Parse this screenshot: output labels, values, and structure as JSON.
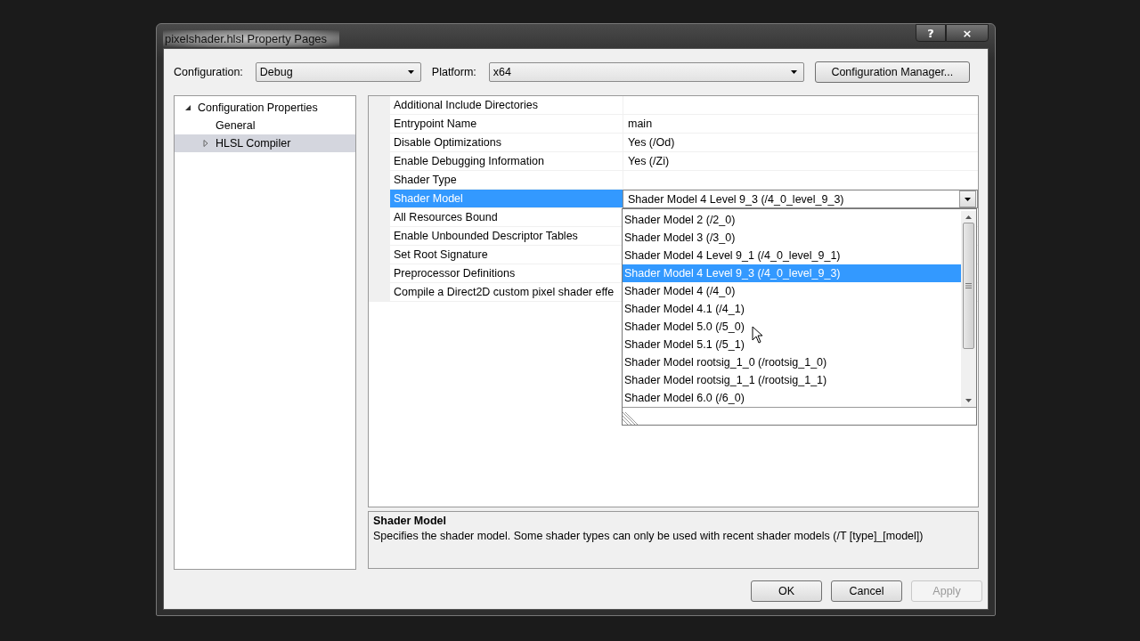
{
  "window": {
    "title": "pixelshader.hlsl Property Pages",
    "controls": [
      "?",
      "×"
    ]
  },
  "toolbar": {
    "configuration": {
      "label": "Configuration:",
      "value": "Debug"
    },
    "platform": {
      "label": "Platform:",
      "value": "x64"
    },
    "manager_button": "Configuration Manager..."
  },
  "tree": [
    {
      "label": "Configuration Properties",
      "expanded": true,
      "selected": false,
      "children": [
        {
          "label": "General",
          "selected": false
        },
        {
          "label": "HLSL Compiler",
          "expanded": false,
          "selected": true
        }
      ]
    }
  ],
  "properties": [
    {
      "name": "Additional Include Directories",
      "selected": false
    },
    {
      "name": "Entrypoint Name",
      "value": "main",
      "selected": false
    },
    {
      "name": "Disable Optimizations",
      "value": "Yes (/Od)",
      "selected": false
    },
    {
      "name": "Enable Debugging Information",
      "value": "Yes (/Zi)",
      "selected": false
    },
    {
      "name": "Shader Type",
      "selected": false
    },
    {
      "name": "Shader Model",
      "value": "Shader Model 4 Level 9_3 (/4_0_level_9_3)",
      "selected": true
    },
    {
      "name": "All Resources Bound",
      "selected": false
    },
    {
      "name": "Enable Unbounded Descriptor Tables",
      "selected": false
    },
    {
      "name": "Set Root Signature",
      "selected": false
    },
    {
      "name": "Preprocessor Definitions",
      "selected": false
    },
    {
      "name": "Compile a Direct2D custom pixel shader effe",
      "selected": false
    }
  ],
  "dropdown": {
    "items": [
      {
        "label": "Shader Model 2 (/2_0)",
        "selected": false
      },
      {
        "label": "Shader Model 3 (/3_0)",
        "selected": false
      },
      {
        "label": "Shader Model 4 Level 9_1 (/4_0_level_9_1)",
        "selected": false
      },
      {
        "label": "Shader Model 4 Level 9_3 (/4_0_level_9_3)",
        "selected": true
      },
      {
        "label": "Shader Model 4 (/4_0)",
        "selected": false
      },
      {
        "label": "Shader Model 4.1 (/4_1)",
        "selected": false
      },
      {
        "label": "Shader Model 5.0 (/5_0)",
        "selected": false
      },
      {
        "label": "Shader Model 5.1 (/5_1)",
        "selected": false
      },
      {
        "label": "Shader Model rootsig_1_0 (/rootsig_1_0)",
        "selected": false
      },
      {
        "label": "Shader Model rootsig_1_1 (/rootsig_1_1)",
        "selected": false
      },
      {
        "label": "Shader Model 6.0 (/6_0)",
        "selected": false
      }
    ]
  },
  "description": {
    "title": "Shader Model",
    "text": "Specifies the shader model. Some shader types can only be used with recent shader models (/T [type]_[model])"
  },
  "buttons": [
    {
      "label": "OK",
      "disabled": false
    },
    {
      "label": "Cancel",
      "disabled": false
    },
    {
      "label": "Apply",
      "disabled": true
    }
  ]
}
